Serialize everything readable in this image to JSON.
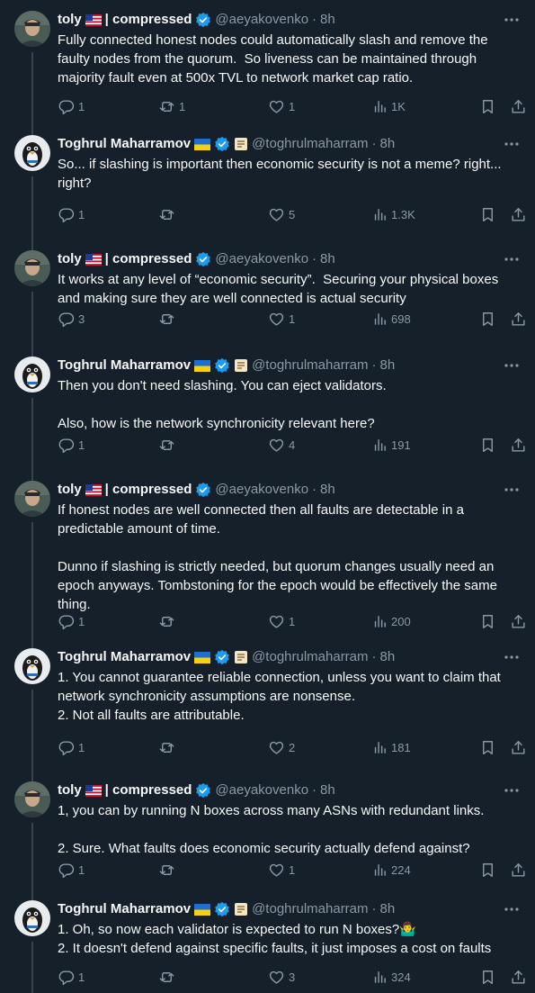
{
  "accounts": {
    "toly": {
      "name": "toly",
      "suffix": "| compressed",
      "handle": "@aeyakovenko"
    },
    "toghrul": {
      "name": "Toghrul Maharramov",
      "handle": "@toghrulmaharram"
    }
  },
  "separator": "·",
  "tweets": [
    {
      "time": "8h",
      "text": "Fully connected honest nodes could automatically slash and remove the faulty nodes from the quorum.  So liveness can be maintained through majority fault even at 500x TVL to network market cap ratio.",
      "replies": "1",
      "reposts": "1",
      "likes": "1",
      "views": "1K"
    },
    {
      "time": "8h",
      "text": "So... if slashing is important then economic security is not a meme? right... right?",
      "replies": "1",
      "reposts": "",
      "likes": "5",
      "views": "1.3K"
    },
    {
      "time": "8h",
      "text": "It works at any level of “economic security”.  Securing your physical boxes and making sure they are well connected is actual security",
      "replies": "3",
      "reposts": "",
      "likes": "1",
      "views": "698"
    },
    {
      "time": "8h",
      "text": "Then you don't need slashing. You can eject validators.\n\nAlso, how is the network synchronicity relevant here?",
      "replies": "1",
      "reposts": "",
      "likes": "4",
      "views": "191"
    },
    {
      "time": "8h",
      "text": "If honest nodes are well connected then all faults are detectable in a predictable amount of time.\n\nDunno if slashing is strictly needed, but quorum changes usually need an epoch anyways. Tombstoning for the epoch would be effectively the same thing.",
      "replies": "1",
      "reposts": "",
      "likes": "1",
      "views": "200"
    },
    {
      "time": "8h",
      "text": "1. You cannot guarantee reliable connection, unless you want to claim that network synchronicity assumptions are nonsense.\n2. Not all faults are attributable.",
      "replies": "1",
      "reposts": "",
      "likes": "2",
      "views": "181"
    },
    {
      "time": "8h",
      "text": "1, you can by running N boxes across many ASNs with redundant links.\n\n2. Sure. What faults does economic security actually defend against?",
      "replies": "1",
      "reposts": "",
      "likes": "1",
      "views": "224"
    },
    {
      "time": "8h",
      "text": "1. Oh, so now each validator is expected to run N boxes?🤷‍♂️\n2. It doesn't defend against specific faults, it just imposes a cost on faults",
      "replies": "1",
      "reposts": "",
      "likes": "3",
      "views": "324"
    }
  ],
  "colors": {
    "background": "#15202b",
    "text": "#f7f9f9",
    "muted": "#8b98a5",
    "verified": "#1d9bf0",
    "divider": "#38444d"
  },
  "icons": [
    "reply-icon",
    "repost-icon",
    "like-icon",
    "views-icon",
    "bookmark-icon",
    "share-icon",
    "more-icon",
    "verified-badge-icon",
    "us-flag-icon",
    "ukraine-flag-icon",
    "scroll-icon"
  ]
}
